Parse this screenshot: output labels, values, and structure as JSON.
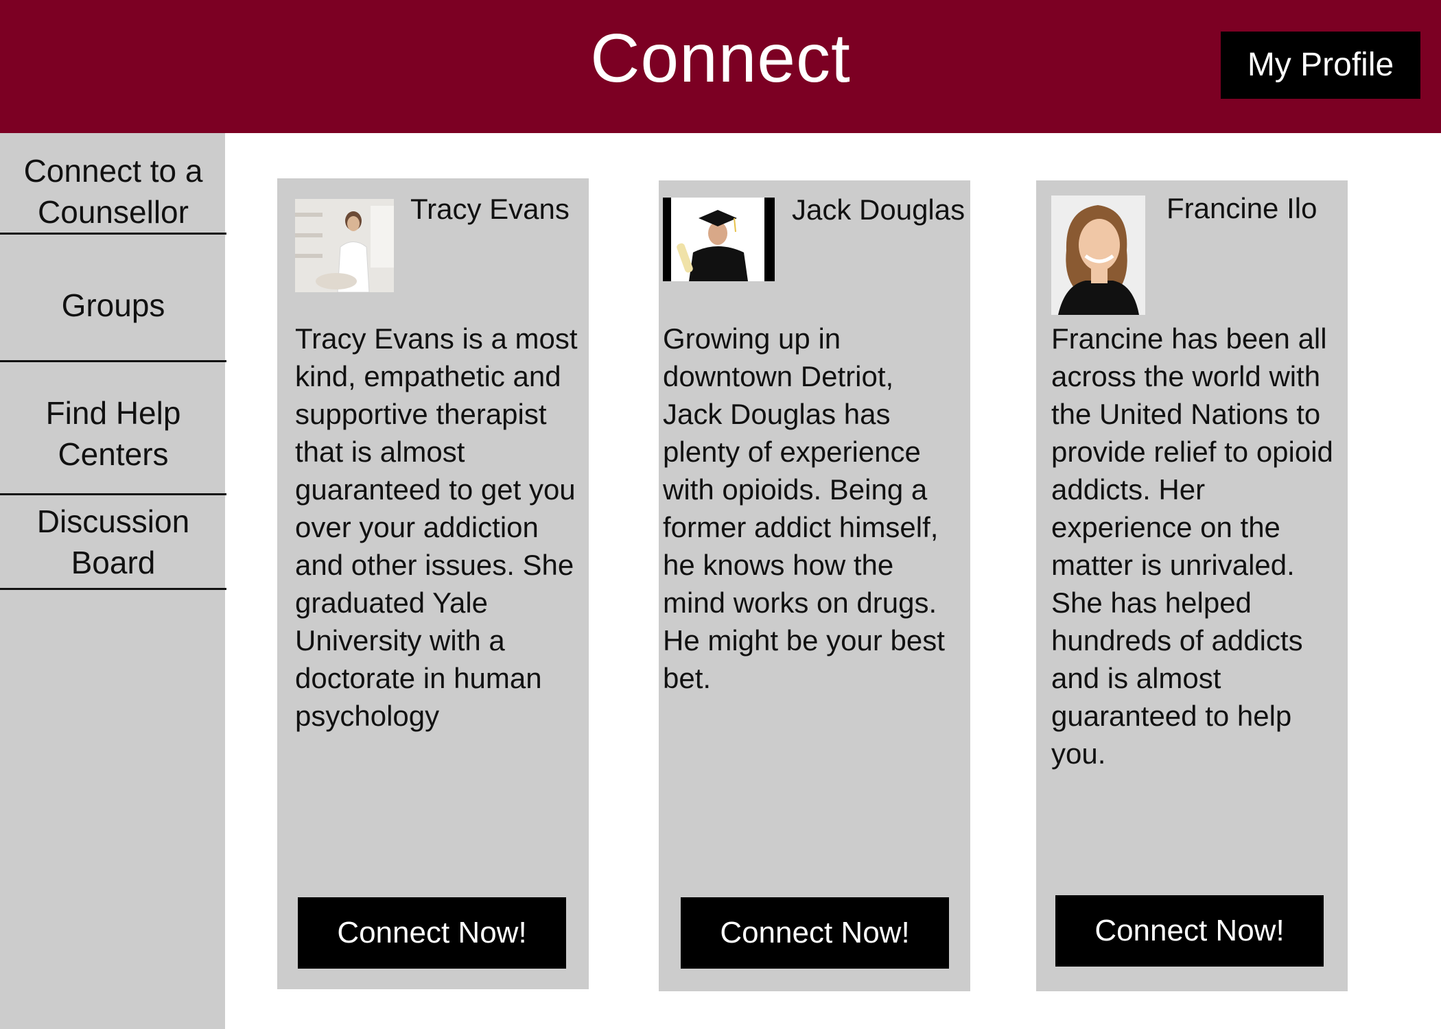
{
  "header": {
    "title": "Connect",
    "profile_button": "My Profile"
  },
  "sidebar": {
    "items": [
      {
        "label": "Connect to a Counsellor"
      },
      {
        "label": "Groups"
      },
      {
        "label": "Find Help Centers"
      },
      {
        "label": "Discussion Board"
      }
    ]
  },
  "counsellors": [
    {
      "name": "Tracy Evans",
      "bio": "Tracy Evans is a most kind, empathetic and supportive therapist that is almost guaranteed to get you over your addiction and other issues. She graduated Yale University with a doctorate in human psychology",
      "button": "Connect Now!"
    },
    {
      "name": "Jack Douglas",
      "bio": "Growing up in downtown Detriot, Jack Douglas has plenty of experience with opioids. Being a former addict himself, he knows how the mind works on drugs. He might be your best bet.",
      "button": "Connect Now!"
    },
    {
      "name": "Francine Ilo",
      "bio": "Francine has been all across the world with the United Nations to provide relief to opioid addicts. Her experience on the matter is unrivaled. She has helped hundreds of addicts and is almost guaranteed to help you.",
      "button": "Connect Now!"
    }
  ],
  "colors": {
    "header_bg": "#7c0023",
    "panel_bg": "#cccccc",
    "button_bg": "#000000"
  }
}
